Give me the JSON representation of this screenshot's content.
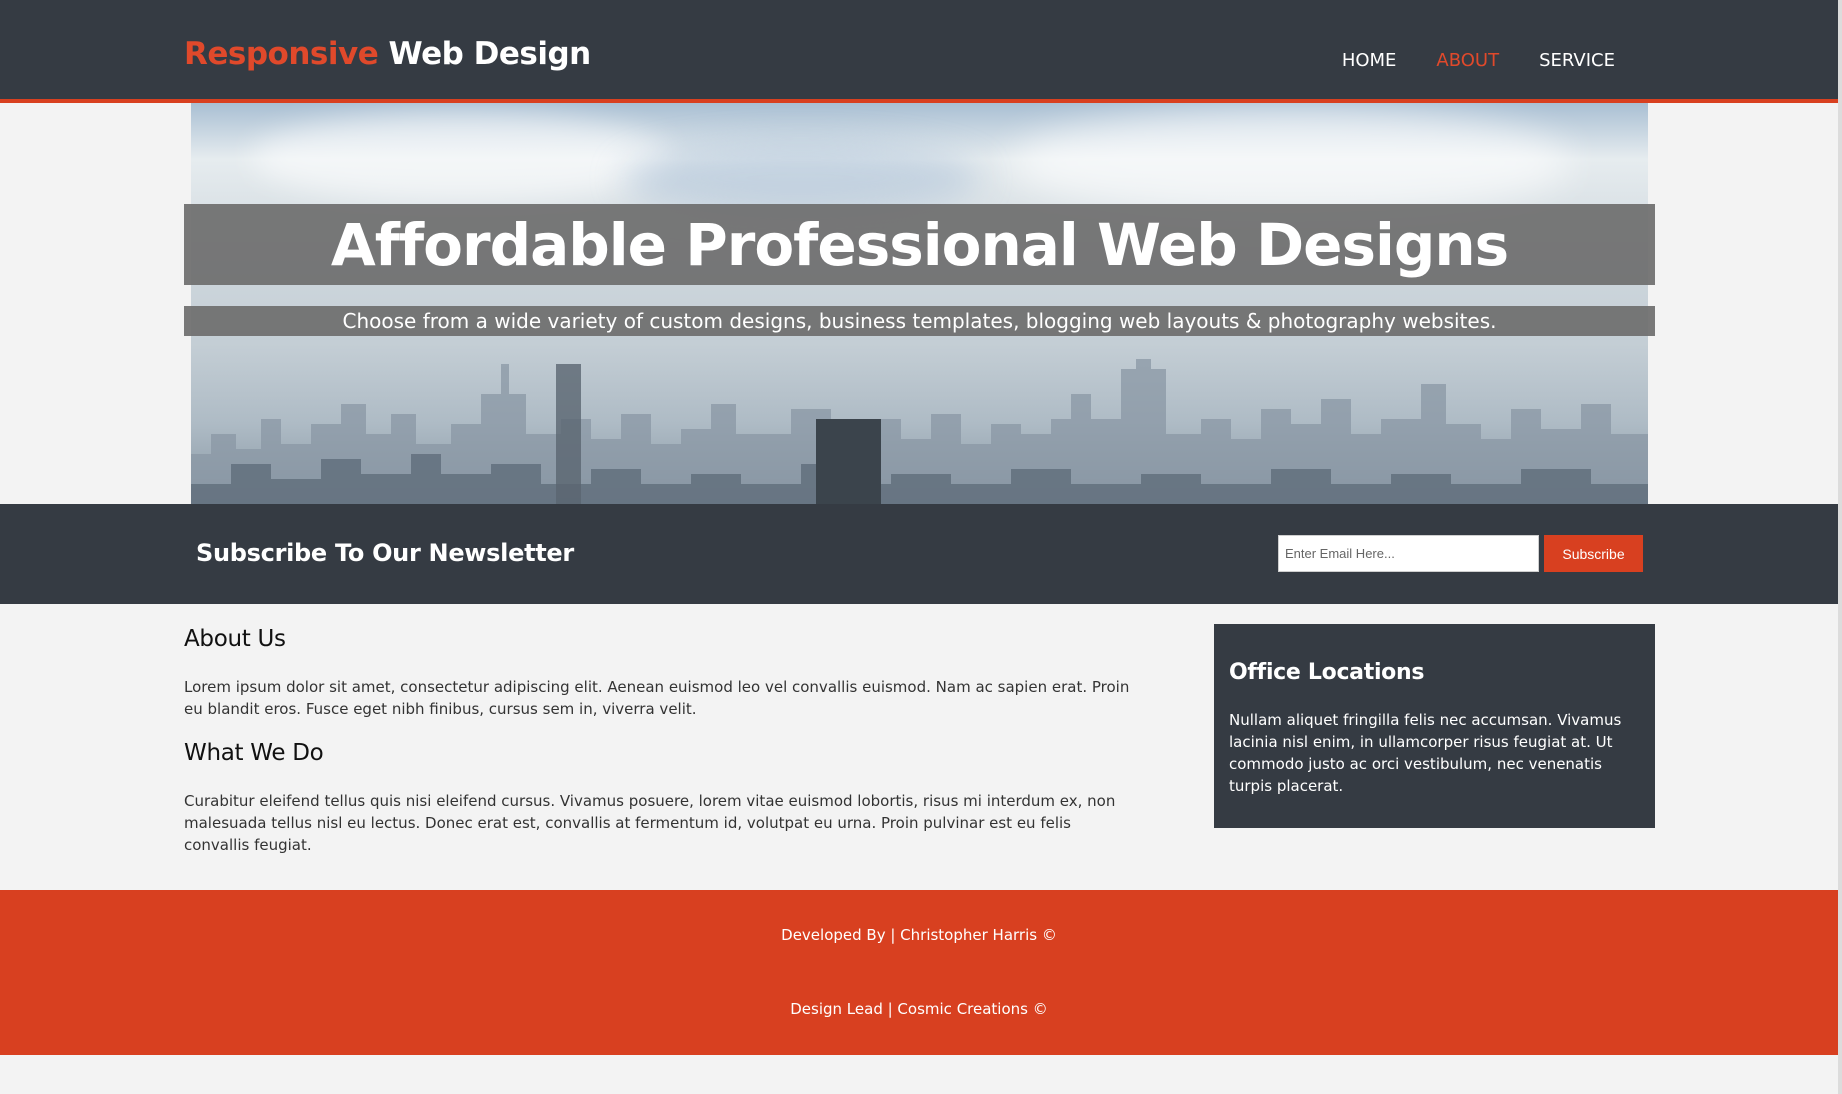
{
  "header": {
    "logo_accent": "Responsive",
    "logo_rest": " Web Design",
    "nav": [
      {
        "label": "HOME"
      },
      {
        "label": "ABOUT"
      },
      {
        "label": "SERVICE"
      }
    ]
  },
  "hero": {
    "title": "Affordable Professional Web Designs",
    "subtitle": "Choose from a wide variety of custom designs, business templates, blogging web layouts & photography websites."
  },
  "newsletter": {
    "title": "Subscribe To Our Newsletter",
    "email_placeholder": "Enter Email Here...",
    "button_label": "Subscribe"
  },
  "main": {
    "about_heading": "About Us",
    "about_text": "Lorem ipsum dolor sit amet, consectetur adipiscing elit. Aenean euismod leo vel convallis euismod. Nam ac sapien erat. Proin eu blandit eros. Fusce eget nibh finibus, cursus sem in, viverra velit.",
    "whatwedo_heading": "What We Do",
    "whatwedo_text": "Curabitur eleifend tellus quis nisi eleifend cursus. Vivamus posuere, lorem vitae euismod lobortis, risus mi interdum ex, non malesuada tellus nisl eu lectus. Donec erat est, convallis at fermentum id, volutpat eu urna. Proin pulvinar est eu felis convallis feugiat."
  },
  "sidebar": {
    "heading": "Office Locations",
    "text": "Nullam aliquet fringilla felis nec accumsan. Vivamus lacinia nisl enim, in ullamcorper risus feugiat at. Ut commodo justo ac orci vestibulum, nec venenatis turpis placerat."
  },
  "footer": {
    "line1": "Developed By | Christopher Harris ©",
    "line2": "Design Lead | Cosmic Creations ©"
  },
  "colors": {
    "accent": "#d84020",
    "dark": "#353b43",
    "background": "#f3f3f3"
  }
}
